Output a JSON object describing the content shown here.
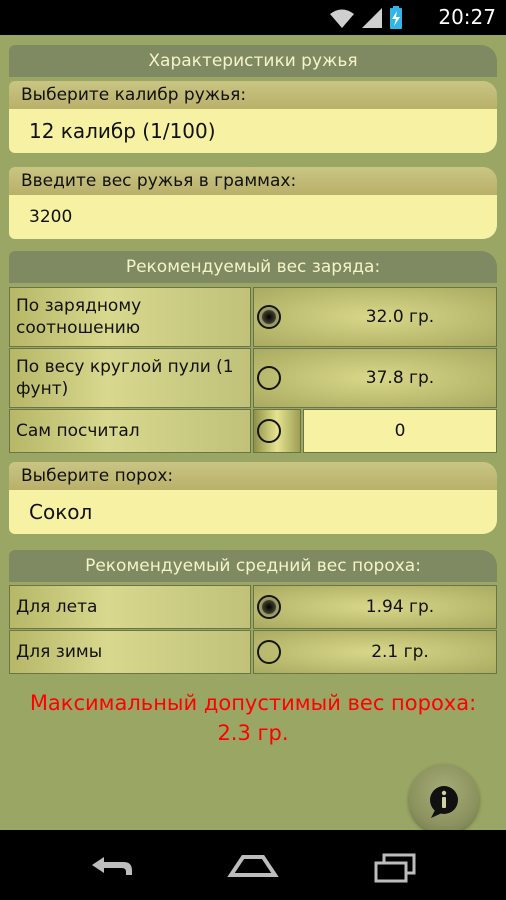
{
  "status_bar": {
    "time": "20:27"
  },
  "sections": {
    "gun": {
      "title": "Характеристики ружья"
    },
    "caliber": {
      "label": "Выберите калибр ружья:",
      "value": "12 калибр (1/100)"
    },
    "weight": {
      "label": "Введите вес ружья в граммах:",
      "value": "3200"
    },
    "charge": {
      "title": "Рекомендуемый вес заряда:",
      "rows": [
        {
          "label": "По зарядному соотношению",
          "value": "32.0 гр.",
          "selected": true
        },
        {
          "label": "По весу круглой пули (1 фунт)",
          "value": "37.8 гр.",
          "selected": false
        },
        {
          "label": "Сам посчитал",
          "value": "0",
          "selected": false
        }
      ]
    },
    "powder": {
      "label": "Выберите порох:",
      "value": "Сокол"
    },
    "avg_powder": {
      "title": "Рекомендуемый средний вес пороха:",
      "rows": [
        {
          "label": "Для лета",
          "value": "1.94 гр.",
          "selected": true
        },
        {
          "label": "Для зимы",
          "value": "2.1 гр.",
          "selected": false
        }
      ]
    },
    "warning": {
      "line1": "Максимальный допустимый вес пороха:",
      "line2": "2.3 гр."
    }
  },
  "colors": {
    "app_bg": "#9aa764",
    "header_bg": "#7f8a62",
    "input_bg": "#f6f1a3",
    "warning": "#ff0000"
  },
  "icons": {
    "wifi": "wifi-icon",
    "signal": "signal-icon",
    "battery": "battery-charging-icon",
    "info": "info-icon"
  }
}
